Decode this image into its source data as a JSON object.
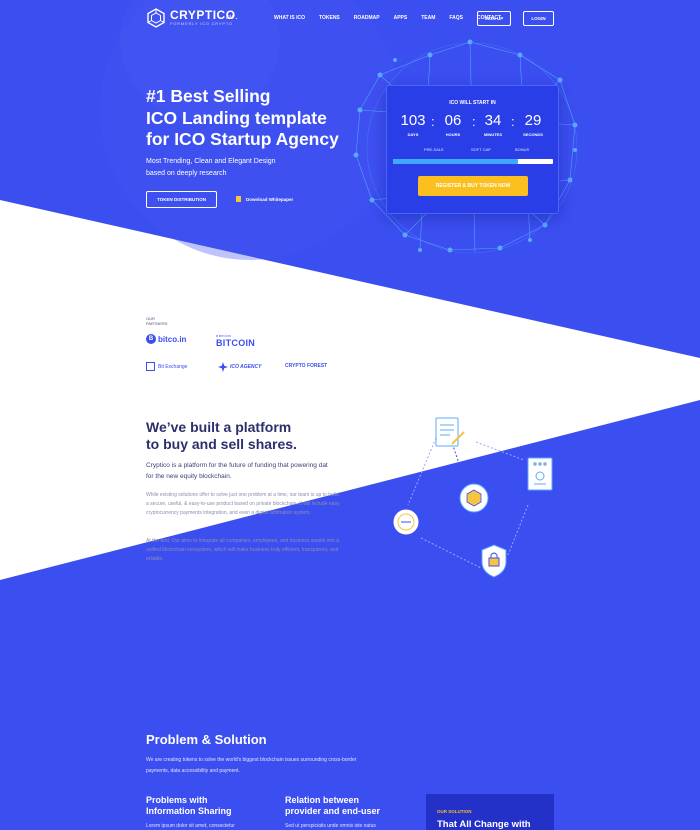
{
  "colors": {
    "primary_blue": "#3b4ef0",
    "accent_yellow": "#fbbf1f",
    "dark_text": "#2b2f6b",
    "muted_text": "#8b8fae"
  },
  "header": {
    "logo_name": "CRYPTICO",
    "logo_tagline": "FORMERLY ICO CRYPTO",
    "language": "EN ⌄",
    "nav": [
      "WHAT IS ICO",
      "TOKENS",
      "ROADMAP",
      "APPS",
      "TEAM",
      "FAQS",
      "CONTACT"
    ],
    "signup_label": "SIGN UP",
    "login_label": "LOGIN"
  },
  "hero": {
    "title_line1": "#1 Best Selling",
    "title_line2": "ICO Landing template",
    "title_line3": "for ICO Startup Agency",
    "subtitle_line1": "Most Trending, Clean and Elegant Design",
    "subtitle_line2": "based on deeply research",
    "token_button": "TOKEN DISTRIBUTION",
    "whitepaper_link": "Download Whitepaper"
  },
  "ico": {
    "heading": "ICO WILL START IN",
    "days": "103",
    "days_label": "DAYS",
    "hours": "06",
    "hours_label": "HOURS",
    "minutes": "34",
    "minutes_label": "MINUTES",
    "seconds": "29",
    "seconds_label": "SECONDS",
    "milestones": [
      "PRE-SALE",
      "SOFT CAP",
      "BONUS"
    ],
    "progress_fraction": 0.78,
    "cta": "REGISTER & BUY TOKEN NOW"
  },
  "partners": {
    "label_line1": "OUR",
    "label_line2": "PARTNERS",
    "bitcoin_in": "bitco.in",
    "bitcoin_small": "B BITCOIN",
    "bitcoin_big": "BITCOIN",
    "bitexchange": "Bit Exchange",
    "icoagency": "ICO AGENCY",
    "cryptoforest": "CRYPTO FOREST"
  },
  "platform": {
    "title_line1": "We’ve built a platform",
    "title_line2": "to buy and sell shares.",
    "lead": "Cryptico is a platform for the future of funding that powering dat for the new equity blockchain.",
    "p1": "While existing solutions offer to solve just one problem at a time, our team is up to build a secure, useful, & easy-to-use product based on private blockchain. It will include easy cryptocurrency payments integration, and even a digital arbitration system.",
    "p2": "At the end, Our aims to integrate all companies, employees, and business assets into a unified blockchain ecosystem, which will make business truly efficient, transparent, and reliable."
  },
  "problem_solution": {
    "title": "Problem & Solution",
    "subtitle": "We are creating tokens to solve the world's biggest blockchain issues surrounding cross-border payments, data accessibility and payment.",
    "col1_title": "Problems with Information Sharing",
    "col1_text": "Lorem ipsum dolor sit amet, consectetur",
    "col2_title": "Relation between provider and end-user",
    "col2_text": "Sed ut perspiciatis unde omnis iste natus",
    "solution_label": "OUR SOLUTION",
    "solution_title": "That All Change with"
  }
}
